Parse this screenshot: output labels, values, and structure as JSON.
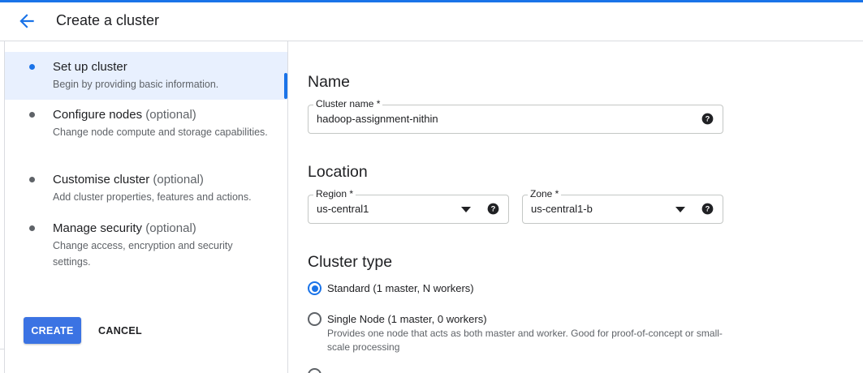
{
  "header": {
    "title": "Create a cluster",
    "back_icon": "arrow-back-icon"
  },
  "steps": [
    {
      "title": "Set up cluster",
      "optional": "",
      "description": "Begin by providing basic information.",
      "active": true
    },
    {
      "title": "Configure nodes",
      "optional": "(optional)",
      "description": "Change node compute and storage capabilities.",
      "active": false
    },
    {
      "title": "Customise cluster",
      "optional": "(optional)",
      "description": "Add cluster properties, features and actions.",
      "active": false
    },
    {
      "title": "Manage security",
      "optional": "(optional)",
      "description": "Change access, encryption and security settings.",
      "active": false
    }
  ],
  "actions": {
    "create_label": "CREATE",
    "cancel_label": "CANCEL"
  },
  "name_section": {
    "heading": "Name",
    "cluster_name_label": "Cluster name *",
    "cluster_name_value": "hadoop-assignment-nithin"
  },
  "location_section": {
    "heading": "Location",
    "region_label": "Region *",
    "region_value": "us-central1",
    "zone_label": "Zone *",
    "zone_value": "us-central1-b"
  },
  "cluster_type_section": {
    "heading": "Cluster type",
    "options": [
      {
        "label": "Standard (1 master, N workers)",
        "description": "",
        "selected": true
      },
      {
        "label": "Single Node (1 master, 0 workers)",
        "description": "Provides one node that acts as both master and worker. Good for proof-of-concept or small-scale processing",
        "selected": false
      }
    ]
  },
  "colors": {
    "accent": "#1a73e8",
    "create_button": "#3b73e3",
    "active_step_bg": "#e8f0fe"
  }
}
